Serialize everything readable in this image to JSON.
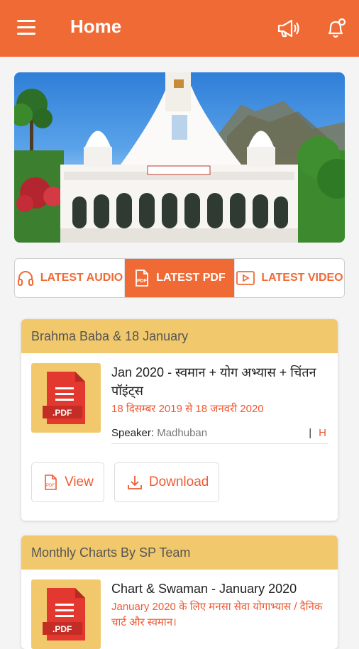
{
  "header": {
    "title": "Home",
    "menu_icon": "menu-icon",
    "announcement_icon": "megaphone-icon",
    "notification_icon": "bell-icon"
  },
  "banner": {
    "alt": "UNIVERSAL PEACE HALL"
  },
  "tabs": [
    {
      "label": "LATEST AUDIO",
      "icon": "headphones-icon",
      "active": false
    },
    {
      "label": "LATEST PDF",
      "icon": "pdf-icon",
      "active": true
    },
    {
      "label": "LATEST VIDEO",
      "icon": "video-icon",
      "active": false
    }
  ],
  "cards": [
    {
      "category": "Brahma Baba & 18 January",
      "title": "Jan 2020 - स्वमान + योग अभ्यास + चिंतन पॉइंट्स",
      "subtitle": "18 दिसम्बर 2019 से 18 जनवरी 2020",
      "speaker_label": "Speaker:",
      "speaker": "Madhuban",
      "separator": "|",
      "language": "H",
      "view_label": "View",
      "download_label": "Download"
    },
    {
      "category": "Monthly Charts By SP Team",
      "title": "Chart & Swaman - January 2020",
      "subtitle": "January 2020 के लिए मनसा सेवा योगाभ्यास / दैनिक चार्ट और स्वमान।"
    }
  ],
  "colors": {
    "primary": "#f06a35",
    "card_header": "#f1c86c",
    "accent_text": "#ef5a33"
  }
}
